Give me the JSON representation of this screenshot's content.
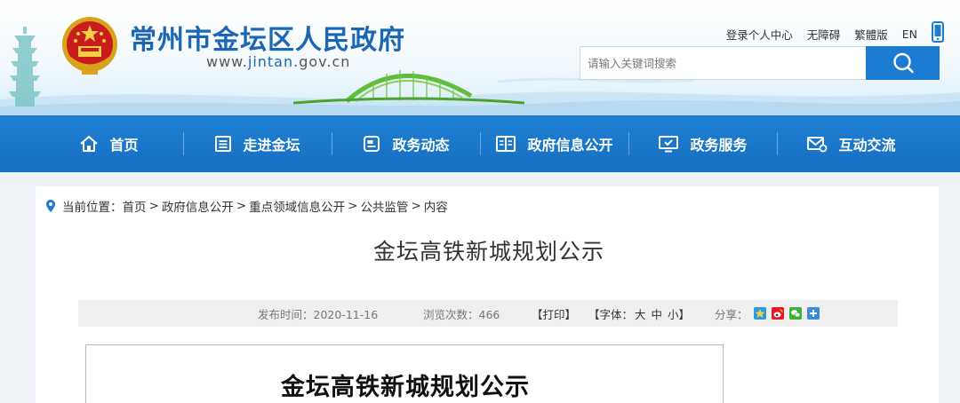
{
  "site": {
    "title": "常州市金坛区人民政府",
    "url_prefix": "www.",
    "url_domain": "jintan",
    "url_suffix": ".gov.cn"
  },
  "toplinks": {
    "login": "登录个人中心",
    "accessible": "无障碍",
    "traditional": "繁體版",
    "english": "EN",
    "mobile_icon": "mobile-phone-icon"
  },
  "search": {
    "placeholder": "请输入关键词搜索",
    "button_icon": "search-icon"
  },
  "nav": {
    "items": [
      {
        "label": "首页",
        "icon": "home-icon"
      },
      {
        "label": "走进金坛",
        "icon": "book-icon"
      },
      {
        "label": "政务动态",
        "icon": "news-icon"
      },
      {
        "label": "政府信息公开",
        "icon": "open-book-icon"
      },
      {
        "label": "政务服务",
        "icon": "monitor-icon"
      },
      {
        "label": "互动交流",
        "icon": "mail-icon"
      }
    ]
  },
  "breadcrumb": {
    "prefix": "当前位置：",
    "items": [
      "首页",
      "政府信息公开",
      "重点领域信息公开",
      "公共监管",
      "内容"
    ],
    "separator": ">"
  },
  "article": {
    "title": "金坛高铁新城规划公示",
    "date_label": "发布时间：2020-11-16",
    "views_label": "浏览次数：466",
    "print_label": "【打印】",
    "font_label_prefix": "【字体：",
    "font_large": "大",
    "font_medium": "中",
    "font_small": "小",
    "font_label_suffix": "】",
    "share_label": "分享：",
    "doc_title": "金坛高铁新城规划公示"
  },
  "colors": {
    "brand_blue": "#1c67b3",
    "nav_blue": "#1a78cc",
    "bridge_green": "#5fbf3a"
  }
}
